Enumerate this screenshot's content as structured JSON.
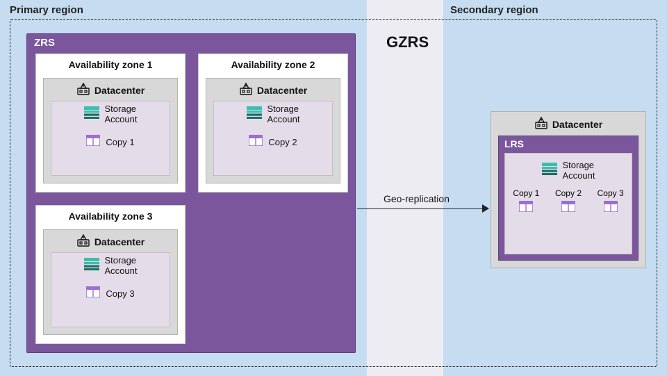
{
  "colors": {
    "region_bg": "#c6dcf0",
    "mid_bg": "#eeecf3",
    "zrs_bg": "#7b569c",
    "lrs_bg": "#7b569c",
    "dc_bg": "#d8d8d8",
    "inner_card_bg": "#e5dce9",
    "storage_teal": "#3bbfad",
    "storage_dark": "#1a6e63",
    "copy_purple": "#9b6dd7",
    "copy_light": "#e8dafd"
  },
  "labels": {
    "primary_region": "Primary region",
    "secondary_region": "Secondary region",
    "gzrs": "GZRS",
    "zrs": "ZRS",
    "lrs": "LRS",
    "datacenter": "Datacenter",
    "storage_account_line1": "Storage",
    "storage_account_line2": "Account",
    "geo_replication": "Geo-replication"
  },
  "primary": {
    "zones": [
      {
        "title": "Availability zone 1",
        "copy": "Copy 1"
      },
      {
        "title": "Availability zone 2",
        "copy": "Copy 2"
      },
      {
        "title": "Availability zone 3",
        "copy": "Copy 3"
      }
    ]
  },
  "secondary": {
    "copies": [
      "Copy 1",
      "Copy 2",
      "Copy 3"
    ]
  }
}
